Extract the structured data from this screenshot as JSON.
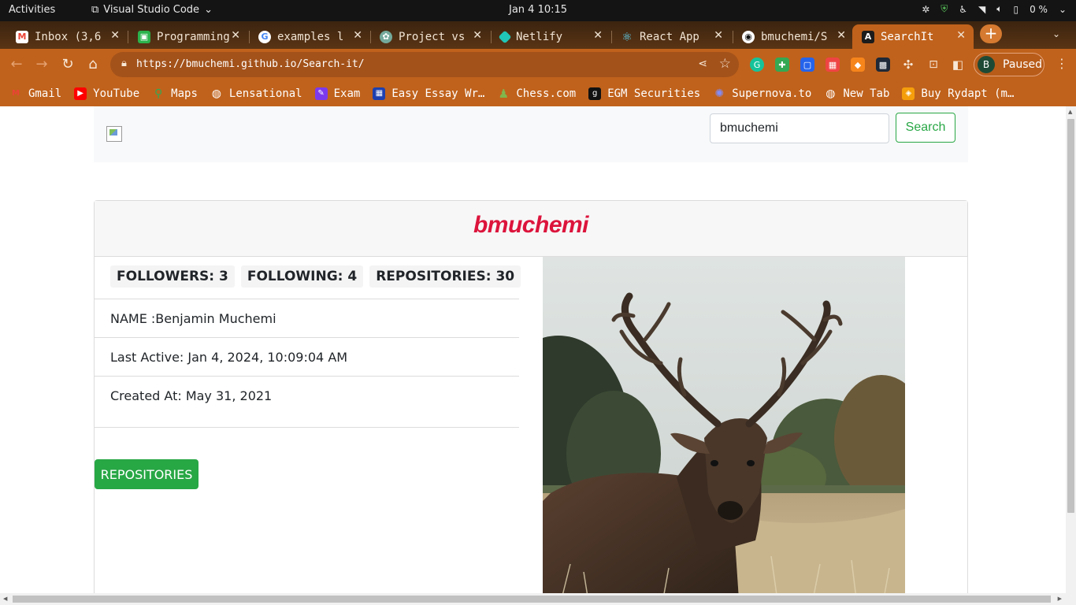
{
  "system": {
    "activities": "Activities",
    "app_name": "Visual Studio Code",
    "clock": "Jan 4  10:15",
    "battery": "0 %"
  },
  "tabs": [
    {
      "title": "Inbox (3,6",
      "icon": "gmail-icon"
    },
    {
      "title": "Programming",
      "icon": "programming-icon"
    },
    {
      "title": "examples l",
      "icon": "google-icon"
    },
    {
      "title": "Project vs",
      "icon": "openai-icon"
    },
    {
      "title": "Netlify",
      "icon": "netlify-icon"
    },
    {
      "title": "React App",
      "icon": "react-icon"
    },
    {
      "title": "bmuchemi/S",
      "icon": "github-icon"
    },
    {
      "title": "SearchIt",
      "icon": "angular-icon"
    }
  ],
  "address_bar": {
    "url": "https://bmuchemi.github.io/Search-it/",
    "profile_initial": "B",
    "profile_status": "Paused"
  },
  "bookmarks": [
    {
      "label": "Gmail",
      "icon": "gmail-icon",
      "color": "#ea4335"
    },
    {
      "label": "YouTube",
      "icon": "youtube-icon",
      "color": "#ff0000"
    },
    {
      "label": "Maps",
      "icon": "maps-icon",
      "color": "#34a853"
    },
    {
      "label": "Lensational",
      "icon": "globe-icon",
      "color": "#ffffff"
    },
    {
      "label": "Exam",
      "icon": "exam-icon",
      "color": "#7c3aed"
    },
    {
      "label": "Easy Essay Wr…",
      "icon": "essay-icon",
      "color": "#1e40af"
    },
    {
      "label": "Chess.com",
      "icon": "chess-icon",
      "color": "#81b64c"
    },
    {
      "label": "EGM Securities",
      "icon": "egm-icon",
      "color": "#111111"
    },
    {
      "label": "Supernova.to",
      "icon": "supernova-icon",
      "color": "#4f46e5"
    },
    {
      "label": "New Tab",
      "icon": "globe-icon",
      "color": "#ffffff"
    },
    {
      "label": "Buy Rydapt (m…",
      "icon": "rydapt-icon",
      "color": "#f59e0b"
    }
  ],
  "page": {
    "search": {
      "value": "bmuchemi",
      "button": "Search"
    },
    "username": "bmuchemi",
    "stats": {
      "followers": "FOLLOWERS: 3",
      "following": "FOLLOWING: 4",
      "repositories": "REPOSITORIES: 30"
    },
    "name": "NAME :Benjamin Muchemi",
    "last_active": "Last Active: Jan 4, 2024, 10:09:04 AM",
    "created_at": "Created At: May 31, 2021",
    "repos_button": "REPOSITORIES",
    "accent": "#dc143c",
    "button_color": "#28a745"
  }
}
